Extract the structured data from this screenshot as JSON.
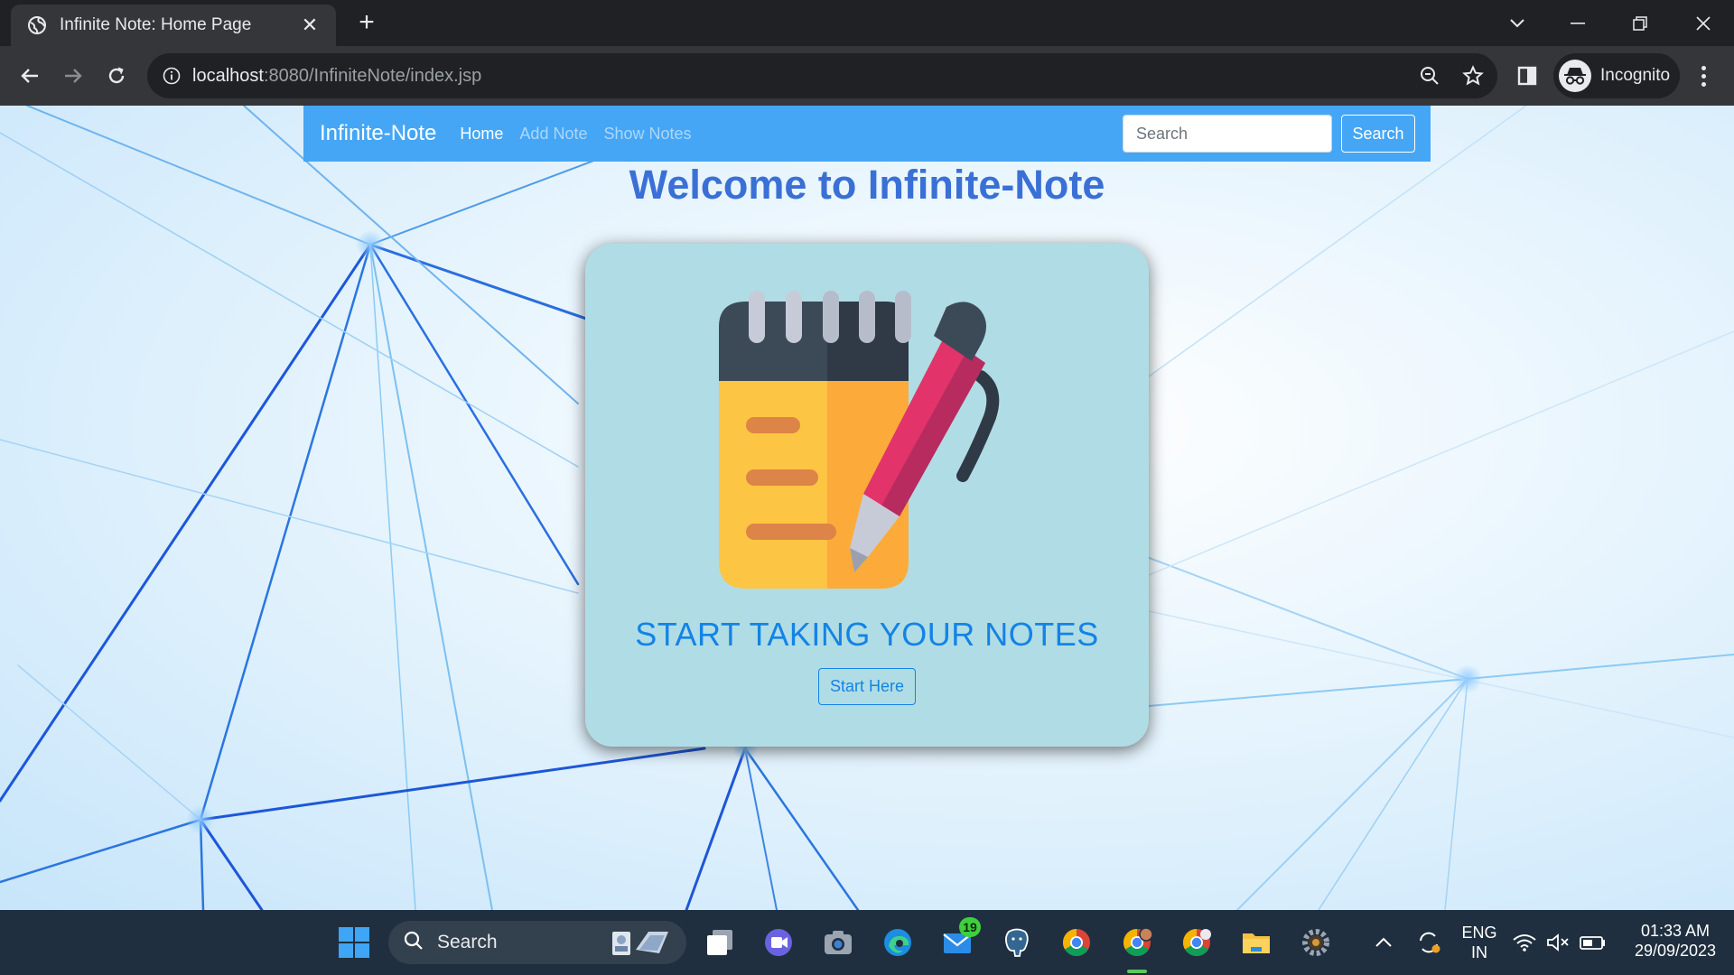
{
  "browser": {
    "tab_title": "Infinite Note: Home Page",
    "url_host": "localhost",
    "url_rest": ":8080/InfiniteNote/index.jsp",
    "profile_label": "Incognito"
  },
  "navbar": {
    "brand": "Infinite-Note",
    "links": [
      {
        "label": "Home",
        "active": true
      },
      {
        "label": "Add Note",
        "active": false
      },
      {
        "label": "Show Notes",
        "active": false
      }
    ],
    "search_placeholder": "Search",
    "search_button": "Search"
  },
  "main": {
    "welcome_heading": "Welcome to Infinite-Note",
    "card_title": "START TAKING YOUR NOTES",
    "start_button": "Start Here"
  },
  "taskbar": {
    "search_label": "Search",
    "mail_badge": "19",
    "language_line1": "ENG",
    "language_line2": "IN",
    "time": "01:33 AM",
    "date": "29/09/2023"
  },
  "colors": {
    "navbar": "#45a6f5",
    "heading": "#3a70d6",
    "card": "#b0dde5",
    "accent": "#1483e6"
  }
}
